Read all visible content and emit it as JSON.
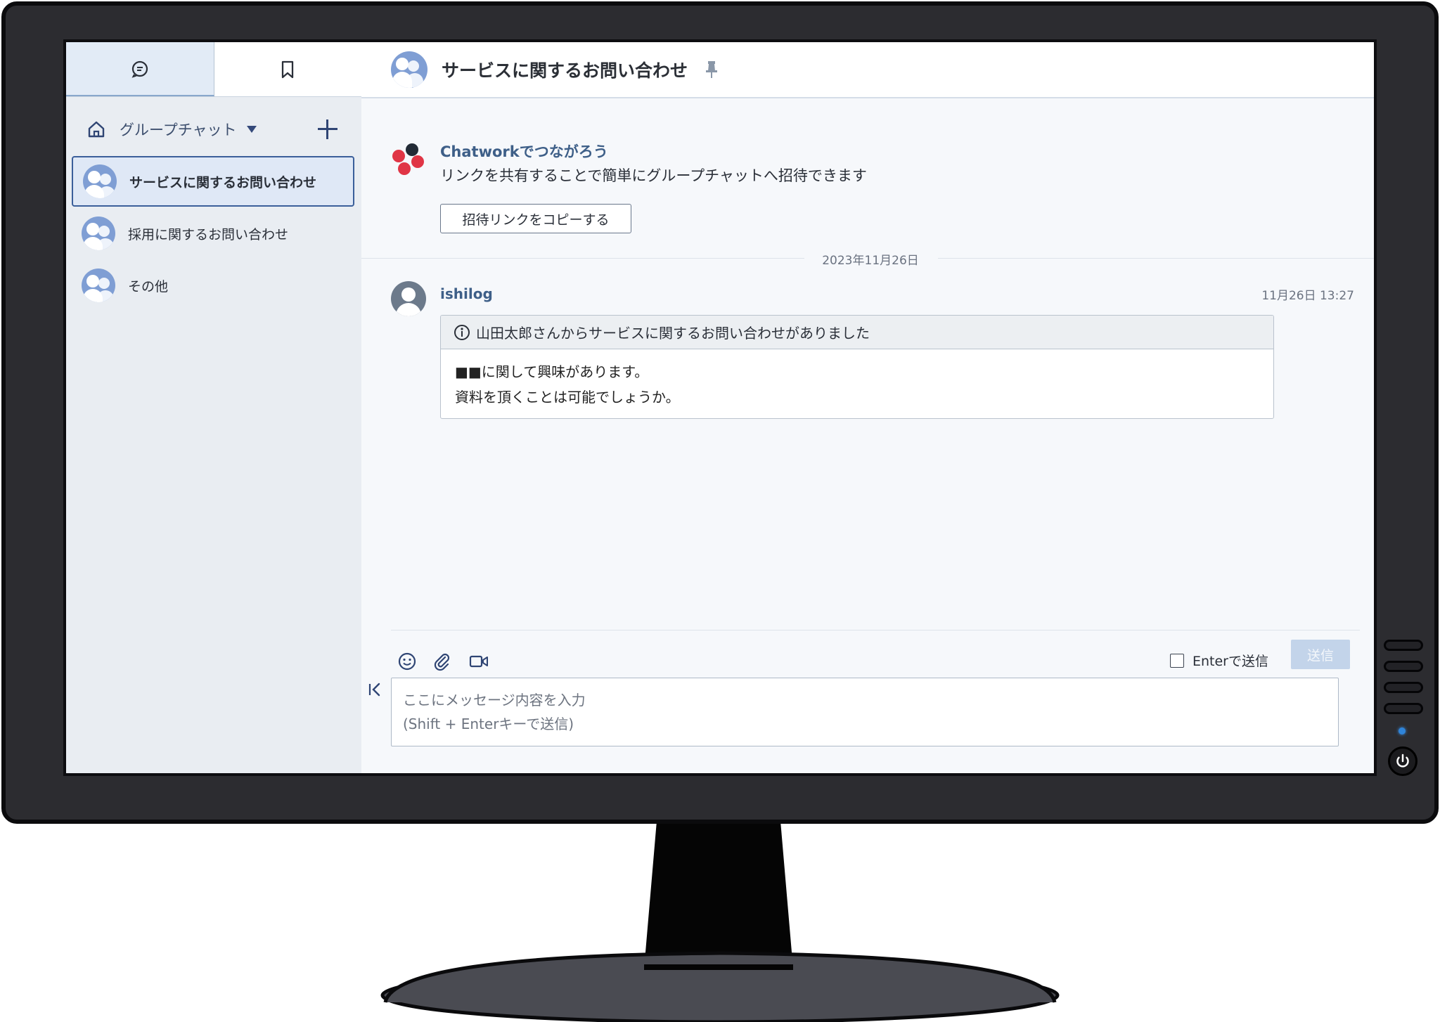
{
  "sidebar": {
    "tabs": [
      {
        "icon": "chat-bubble-icon",
        "active": true
      },
      {
        "icon": "bookmark-icon",
        "active": false
      }
    ],
    "category_label": "グループチャット",
    "rooms": [
      {
        "label": "サービスに関するお問い合わせ",
        "active": true
      },
      {
        "label": "採用に関するお問い合わせ",
        "active": false
      },
      {
        "label": "その他",
        "active": false
      }
    ]
  },
  "room": {
    "title": "サービスに関するお問い合わせ"
  },
  "invite": {
    "title": "Chatworkでつながろう",
    "text": "リンクを共有することで簡単にグループチャットへ招待できます",
    "copy_button": "招待リンクをコピーする"
  },
  "timeline": {
    "date_separator": "2023年11月26日",
    "messages": [
      {
        "user": "ishilog",
        "time": "11月26日 13:27",
        "info_title": "山田太郎さんからサービスに関するお問い合わせがありました",
        "body_line1": "■■に関して興味があります。",
        "body_line2": "資料を頂くことは可能でしょうか。"
      }
    ]
  },
  "composer": {
    "tools": [
      "emoji-icon",
      "attachment-icon",
      "video-call-icon"
    ],
    "enter_to_send_label": "Enterで送信",
    "enter_to_send_checked": false,
    "send_button": "送信",
    "placeholder": "ここにメッセージ内容を入力\n(Shift + Enterキーで送信)"
  },
  "colors": {
    "accent_blue": "#3e5f88",
    "send_disabled": "#c3d4ea",
    "monitor_bezel": "#2c2c30"
  }
}
